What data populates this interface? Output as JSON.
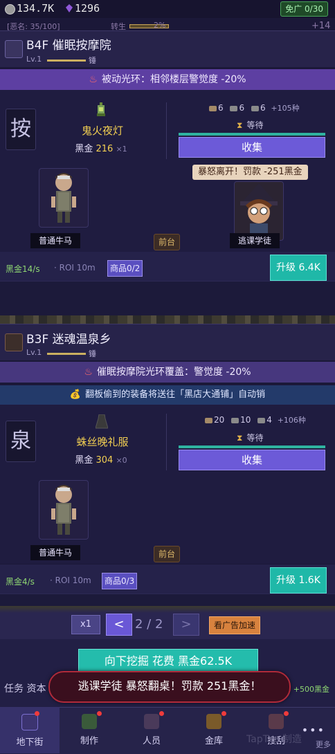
{
  "status": {
    "coins": "134.7K",
    "gems": "1296",
    "ad_free": "免广 0/30",
    "reputation": "[恶名: 35/100]",
    "conversion_label": "转生",
    "conversion_pct": "2%",
    "right_plus": "+14"
  },
  "floors": [
    {
      "title": "B4F  催眠按摩院",
      "level": "Lv.1",
      "lock": "锤",
      "aura": "被动光环：相邻楼层警觉度 -20%",
      "char": "按",
      "item_name": "鬼火夜灯",
      "item_price_label": "黑金",
      "item_price": "216",
      "item_mult": "×1",
      "stock": [
        "6",
        "6",
        "6"
      ],
      "stock_more": "+105种",
      "wait": "等待",
      "collect": "收集",
      "rage": "暴怒离开！罚款 -251黑金",
      "workers": [
        "普通牛马",
        "逃课学徒"
      ],
      "front_desk": "前台",
      "income": "黑金14/s",
      "roi": "· ROI 10m",
      "goods": "商品0/2",
      "upgrade": "升级 6.4K"
    },
    {
      "title": "B3F  迷魂温泉乡",
      "level": "Lv.1",
      "lock": "锤",
      "aura": "催眠按摩院光环覆盖：警觉度 -20%",
      "tip": "翻板偷到的装备将送往「黑店大通铺」自动销",
      "char": "泉",
      "item_name": "蛛丝晚礼服",
      "item_price_label": "黑金",
      "item_price": "304",
      "item_mult": "×0",
      "stock": [
        "20",
        "10",
        "4"
      ],
      "stock_more": "+106种",
      "wait": "等待",
      "collect": "收集",
      "workers": [
        "普通牛马"
      ],
      "front_desk": "前台",
      "income": "黑金4/s",
      "roi": "· ROI 10m",
      "goods": "商品0/3",
      "upgrade": "升级 1.6K"
    }
  ],
  "pager": {
    "mult": "x1",
    "prev": "<",
    "page": "2 / 2",
    "next": ">",
    "ad_speed": "看广告加速"
  },
  "dig": {
    "label": "向下挖掘  花费 黑金62.5K"
  },
  "task": {
    "label": "任务 资本",
    "reward": "+500黑金"
  },
  "toast": "逃课学徒 暴怒翻桌！罚款 251黑金！",
  "nav": {
    "items": [
      "地下街",
      "制作",
      "人员",
      "金库",
      "搜刮"
    ],
    "more": "更多",
    "watermark": "TapTap 制造"
  }
}
